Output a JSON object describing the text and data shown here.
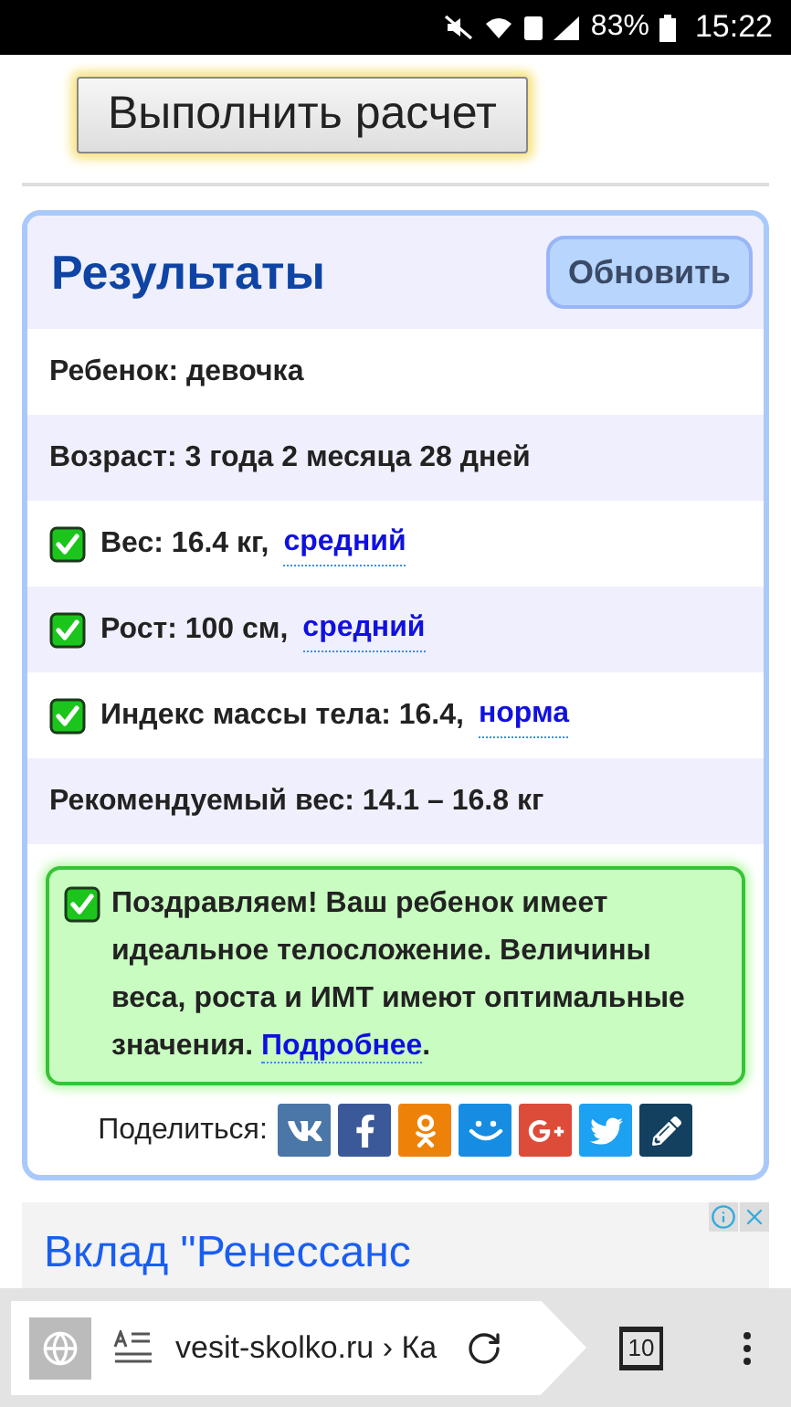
{
  "status_bar": {
    "battery": "83%",
    "time": "15:22"
  },
  "calculate_button": "Выполнить расчет",
  "results": {
    "title": "Результаты",
    "refresh_button": "Обновить",
    "rows": [
      {
        "kind": "plain",
        "text": "Ребенок: девочка"
      },
      {
        "kind": "plain",
        "text": "Возраст: 3 года 2 месяца 28 дней"
      },
      {
        "kind": "check",
        "text": "Вес: 16.4 кг,",
        "link": "средний"
      },
      {
        "kind": "check",
        "text": "Рост: 100 см,",
        "link": "средний"
      },
      {
        "kind": "check",
        "text": "Индекс массы тела: 16.4,",
        "link": "норма"
      },
      {
        "kind": "plain",
        "text": "Рекомендуемый вес: 14.1 – 16.8 кг"
      }
    ],
    "verdict": {
      "text": "Поздравляем! Ваш ребенок имеет идеальное телосложение. Величины веса, роста и ИМТ имеют оптимальные значения.",
      "link": "Подробнее",
      "tail": "."
    },
    "share_label": "Поделиться:",
    "share": [
      {
        "kind": "vk",
        "color": "#4a76a8"
      },
      {
        "kind": "facebook",
        "color": "#3b5998"
      },
      {
        "kind": "ok",
        "color": "#ee8208"
      },
      {
        "kind": "smile",
        "color": "#168de2"
      },
      {
        "kind": "gplus",
        "color": "#dd4b39"
      },
      {
        "kind": "twitter",
        "color": "#1da1f2"
      },
      {
        "kind": "pencil",
        "color": "#12405e"
      }
    ]
  },
  "ad": {
    "title": "Вклад \"Ренессанс"
  },
  "browser_bar": {
    "url": "vesit-skolko.ru › Ка",
    "tabs": "10"
  }
}
